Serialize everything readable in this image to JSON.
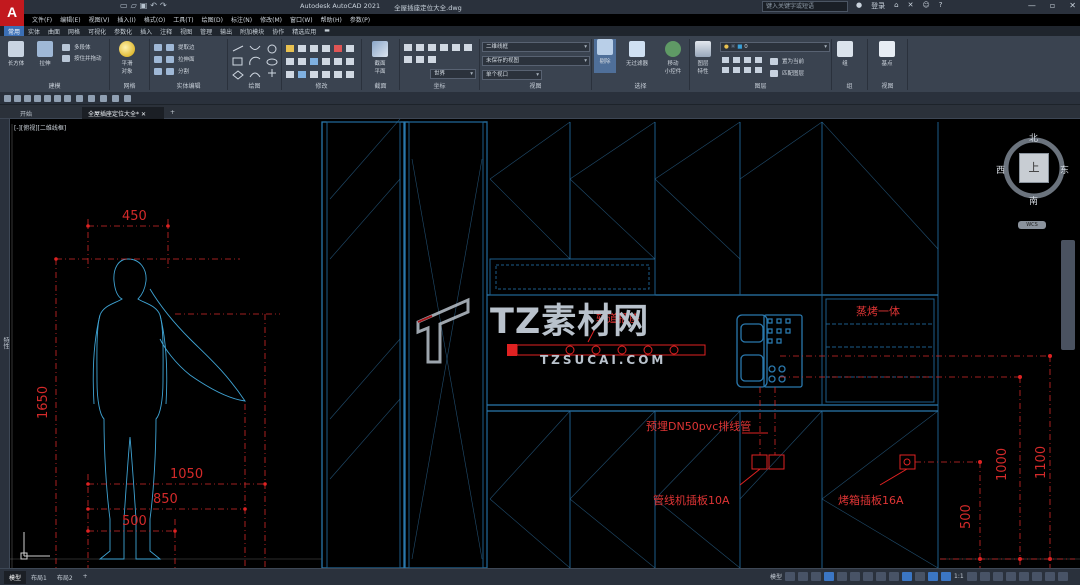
{
  "app": {
    "logo_letter": "A",
    "window_title": "Autodesk AutoCAD 2021",
    "file_name": "全屋插座定位大全.dwg",
    "search_placeholder": "键入关键字或短语",
    "login": "登录",
    "help": "?"
  },
  "menus": [
    "文件(F)",
    "编辑(E)",
    "视图(V)",
    "插入(I)",
    "格式(O)",
    "工具(T)",
    "绘图(D)",
    "标注(N)",
    "修改(M)",
    "窗口(W)",
    "帮助(H)",
    "参数(P)"
  ],
  "ribbon_tabs": [
    "常用",
    "实体",
    "曲面",
    "网格",
    "可视化",
    "参数化",
    "插入",
    "注释",
    "视图",
    "管理",
    "输出",
    "附加模块",
    "协作",
    "精选应用"
  ],
  "ribbon_active_tab": "常用",
  "ribbon": {
    "model_panel": {
      "btn1": "长方体",
      "btn2": "拉伸",
      "row1": "多段体",
      "row2": "按住并拖动",
      "label": "建模"
    },
    "mesh_panel": {
      "btn": "平滑\n对象",
      "label": "网格"
    },
    "solid_edit": {
      "rows": [
        "提取边",
        "拉伸面",
        "分割"
      ],
      "label": "实体编辑"
    },
    "draw_label": "绘图",
    "modify_label": "修改",
    "section_panel": {
      "btn": "截面\n平面",
      "label": "截面"
    },
    "coords_panel": {
      "world": "世界",
      "label": "坐标"
    },
    "view_panel": {
      "visual_style": "二维线框",
      "saved_view": "未保存的视图",
      "viewports": "单个视口",
      "label": "视图"
    },
    "select_panel": {
      "culling": "剔除",
      "filter": "无过滤器",
      "gizmo": "移动\n小控件",
      "label": "选择"
    },
    "layers_panel": {
      "props": "图层\n特性",
      "current_layer": "0",
      "set_current": "置为当前",
      "match": "匹配图层",
      "label": "图层"
    },
    "groups_panel": {
      "btn": "组",
      "label": "组"
    },
    "base_panel": {
      "btn": "基点",
      "label": "视图"
    }
  },
  "doc_tabs": {
    "start": "开始",
    "file": "全屋插座定位大全*",
    "add": "+"
  },
  "viewport_label": "[-][俯视][二维线框]",
  "sidebar_label": "特性",
  "viewcube": {
    "north": "北",
    "south": "南",
    "east": "东",
    "west": "西",
    "face": "上",
    "wcs": "WCS"
  },
  "drawing": {
    "dims": {
      "arm_span": "450",
      "height": "1650",
      "d1050": "1050",
      "d850": "850",
      "d500": "500",
      "d1000": "1000",
      "d1100": "1100",
      "d500_right": "500"
    },
    "labels": {
      "strip_socket": "轨道插座",
      "steam_oven": "蒸烤一体",
      "pipe": "预埋DN50pvc排线管",
      "disposer": "管线机插板10A",
      "oven_socket": "烤箱插板16A"
    },
    "watermark": {
      "main": "TZ素材网",
      "sub": "TZSUCAI.COM"
    },
    "colors": {
      "line": "#1c5d8a",
      "cyan": "#4aa8d6",
      "red": "#e02222",
      "dim_red": "#d42a2a",
      "gray": "#6a6a6a"
    }
  },
  "layout_tabs": [
    "模型",
    "布局1",
    "布局2",
    "+"
  ],
  "status": {
    "mode": "模型",
    "scale": "1:1"
  }
}
